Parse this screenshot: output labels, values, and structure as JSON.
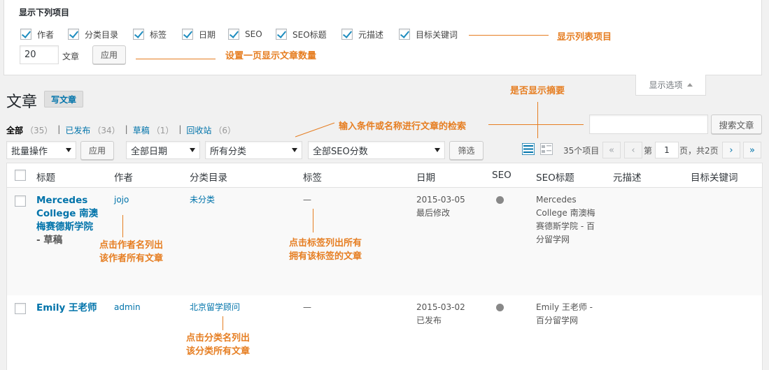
{
  "screen_options": {
    "title": "显示下列项目",
    "columns": [
      {
        "label": "作者",
        "checked": true
      },
      {
        "label": "分类目录",
        "checked": true
      },
      {
        "label": "标签",
        "checked": true
      },
      {
        "label": "日期",
        "checked": true
      },
      {
        "label": "SEO",
        "checked": true
      },
      {
        "label": "SEO标题",
        "checked": true
      },
      {
        "label": "元描述",
        "checked": true
      },
      {
        "label": "目标关键词",
        "checked": true
      }
    ],
    "per_page_value": "20",
    "per_page_label": "文章",
    "apply_label": "应用",
    "tab_label": "显示选项"
  },
  "annotations": {
    "columns_note": "显示列表项目",
    "per_page_note": "设置一页显示文章数量",
    "excerpt_note": "是否显示摘要",
    "search_note": "输入条件或名称进行文章的检索",
    "author_note_1": "点击作者名列出",
    "author_note_2": "该作者所有文章",
    "tag_note_1": "点击标签列出所有",
    "tag_note_2": "拥有该标签的文章",
    "category_note_1": "点击分类名列出",
    "category_note_2": "该分类所有文章"
  },
  "header": {
    "title": "文章",
    "add_new": "写文章"
  },
  "status_filters": [
    {
      "label": "全部",
      "count": "（35）"
    },
    {
      "label": "已发布",
      "count": "（34）"
    },
    {
      "label": "草稿",
      "count": "（1）"
    },
    {
      "label": "回收站",
      "count": "（6）"
    }
  ],
  "search": {
    "value": "",
    "button": "搜索文章"
  },
  "toolbar": {
    "bulk_action": "批量操作",
    "apply": "应用",
    "date_filter": "全部日期",
    "category_filter": "所有分类",
    "seo_filter": "全部SEO分数",
    "filter_button": "筛选"
  },
  "pagination": {
    "items": "35个项目",
    "first": "«",
    "prev": "‹",
    "page_prefix": "第",
    "current_page": "1",
    "page_suffix": "页，共2页",
    "next": "›",
    "last": "»"
  },
  "table": {
    "headers": {
      "title": "标题",
      "author": "作者",
      "categories": "分类目录",
      "tags": "标签",
      "date": "日期",
      "seo": "SEO",
      "seo_title": "SEO标题",
      "meta_desc": "元描述",
      "focus_kw": "目标关键词"
    },
    "rows": [
      {
        "title_l1": "Mercedes",
        "title_l2": "College 南澳",
        "title_l3": "梅赛德斯学院",
        "state": "- 草稿",
        "author": "jojo",
        "category": "未分类",
        "tags": "—",
        "date": "2015-03-05",
        "date_status": "最后修改",
        "seo_title_l1": "Mercedes",
        "seo_title_l2": "College 南澳梅",
        "seo_title_l3": "赛德斯学院 - 百",
        "seo_title_l4": "分留学网"
      },
      {
        "title_l1": "Emily 王老师",
        "author": "admin",
        "category": "北京留学顾问",
        "tags": "—",
        "date": "2015-03-02",
        "date_status": "已发布",
        "seo_title_l1": "Emily 王老师 -",
        "seo_title_l2": "百分留学网"
      }
    ]
  },
  "colors": {
    "annotation": "#e67e22",
    "link": "#0073aa",
    "seo_dot": "#888888"
  }
}
